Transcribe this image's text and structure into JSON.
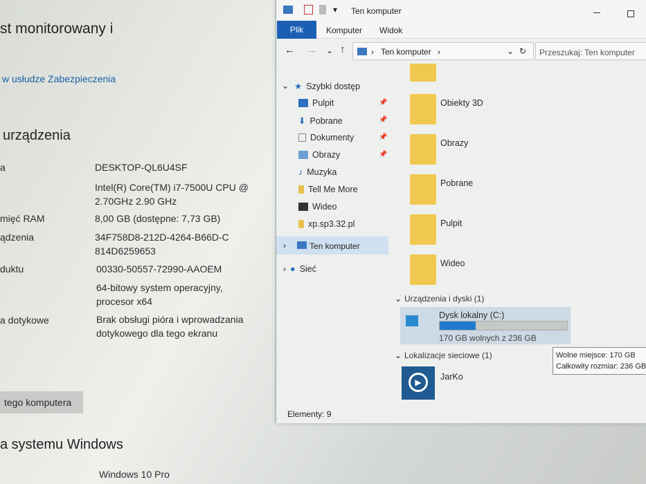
{
  "settings": {
    "monitored": "st monitorowany i",
    "security_link": "w usłudze Zabezpieczenia",
    "device_heading": "urządzenia",
    "rows": [
      {
        "label": "a",
        "value": "DESKTOP-QL6U4SF"
      },
      {
        "label": "",
        "value": "Intel(R) Core(TM) i7-7500U CPU @ 2.70GHz   2.90 GHz"
      },
      {
        "label": "mięć RAM",
        "value": "8,00 GB (dostępne: 7,73 GB)"
      },
      {
        "label": "ądzenia",
        "value": "34F758D8-212D-4264-B66D-C814D6259653"
      },
      {
        "label": "duktu",
        "value": "00330-50557-72990-AAOEM"
      },
      {
        "label": "",
        "value": "64-bitowy system operacyjny, procesor x64"
      },
      {
        "label": "a dotykowe",
        "value": "Brak obsługi pióra i wprowadzania dotykowego dla tego ekranu"
      }
    ],
    "rename_button": "tego komputera",
    "windows_heading": "a systemu Windows",
    "edition": "Windows 10 Pro"
  },
  "explorer": {
    "title": "Ten komputer",
    "tabs": [
      "Plik",
      "Komputer",
      "Widok"
    ],
    "path": [
      "Ten komputer"
    ],
    "search_placeholder": "Przeszukaj: Ten komputer",
    "nav": {
      "quick_access": "Szybki dostęp",
      "items": [
        "Pulpit",
        "Pobrane",
        "Dokumenty",
        "Obrazy",
        "Muzyka",
        "Tell Me More",
        "Wideo",
        "xp.sp3.32.pl"
      ],
      "this_pc": "Ten komputer",
      "network": "Sieć"
    },
    "folders": [
      "Obiekty 3D",
      "Obrazy",
      "Pobrane",
      "Pulpit",
      "Wideo"
    ],
    "devices_group": "Urządzenia i dyski (1)",
    "drive": {
      "name": "Dysk lokalny (C:)",
      "free_text": "170 GB wolnych z 236 GB",
      "used_fraction": 0.28
    },
    "network_group": "Lokalizacje sieciowe (1)",
    "network_item": "JarKo",
    "tooltip": {
      "free": "Wolne miejsce: 170 GB",
      "total": "Całkowity rozmiar: 236 GB"
    },
    "status": "Elementy: 9"
  }
}
